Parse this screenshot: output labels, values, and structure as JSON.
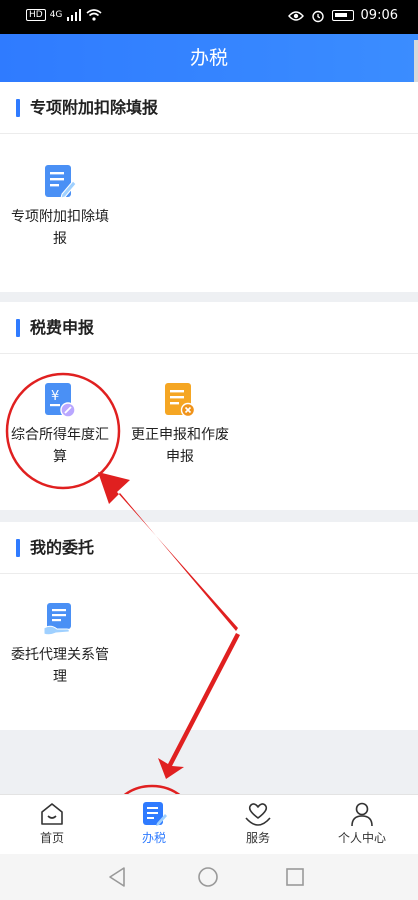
{
  "status": {
    "network": "HD",
    "signal_label": "4G",
    "time": "09:06"
  },
  "header": {
    "title": "办税"
  },
  "sections": [
    {
      "title": "专项附加扣除填报",
      "tiles": [
        {
          "label": "专项附加扣除填报",
          "icon": "doc-edit-icon"
        }
      ]
    },
    {
      "title": "税费申报",
      "tiles": [
        {
          "label": "综合所得年度汇算",
          "icon": "yuan-doc-icon"
        },
        {
          "label": "更正申报和作废申报",
          "icon": "doc-cancel-icon"
        }
      ]
    },
    {
      "title": "我的委托",
      "tiles": [
        {
          "label": "委托代理关系管理",
          "icon": "doc-hand-icon"
        }
      ]
    }
  ],
  "tabs": [
    {
      "label": "首页",
      "icon": "home-icon",
      "active": false
    },
    {
      "label": "办税",
      "icon": "tax-doc-icon",
      "active": true
    },
    {
      "label": "服务",
      "icon": "heart-hand-icon",
      "active": false
    },
    {
      "label": "个人中心",
      "icon": "person-icon",
      "active": false
    }
  ],
  "colors": {
    "brand": "#2f7bff",
    "annotation": "#e02020",
    "tile_orange": "#f5a623"
  }
}
